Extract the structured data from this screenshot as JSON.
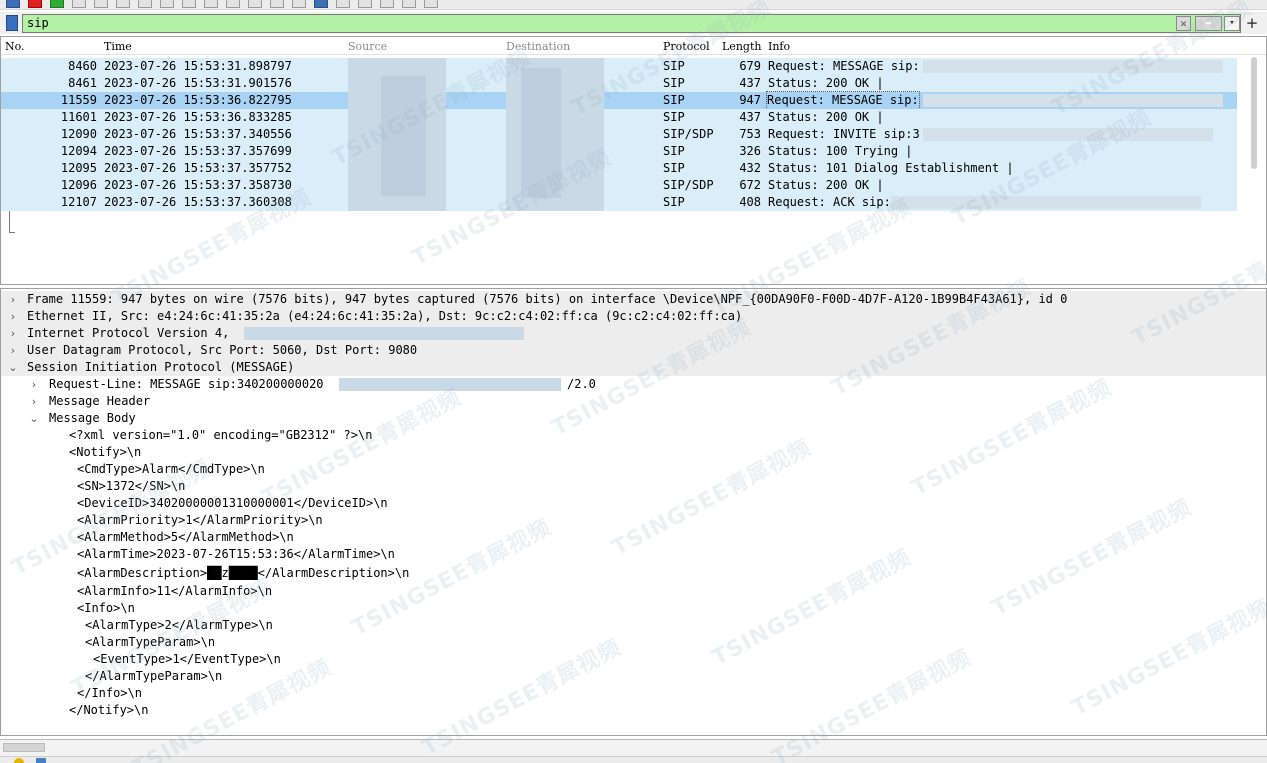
{
  "filter": {
    "value": "sip"
  },
  "packet_list": {
    "columns": [
      "No.",
      "Time",
      "Source",
      "Destination",
      "Protocol",
      "Length",
      "Info"
    ],
    "rows": [
      {
        "no": "8460",
        "time": "2023-07-26 15:53:31.898797",
        "proto": "SIP",
        "len": "679",
        "info": "Request: MESSAGE sip:",
        "selected": false
      },
      {
        "no": "8461",
        "time": "2023-07-26 15:53:31.901576",
        "proto": "SIP",
        "len": "437",
        "info": "Status: 200 OK |",
        "selected": false
      },
      {
        "no": "11559",
        "time": "2023-07-26 15:53:36.822795",
        "proto": "SIP",
        "len": "947",
        "info": "Request: MESSAGE sip:",
        "selected": true
      },
      {
        "no": "11601",
        "time": "2023-07-26 15:53:36.833285",
        "proto": "SIP",
        "len": "437",
        "info": "Status: 200 OK |",
        "selected": false
      },
      {
        "no": "12090",
        "time": "2023-07-26 15:53:37.340556",
        "proto": "SIP/SDP",
        "len": "753",
        "info": "Request: INVITE sip:3",
        "selected": false
      },
      {
        "no": "12094",
        "time": "2023-07-26 15:53:37.357699",
        "proto": "SIP",
        "len": "326",
        "info": "Status: 100 Trying |",
        "selected": false
      },
      {
        "no": "12095",
        "time": "2023-07-26 15:53:37.357752",
        "proto": "SIP",
        "len": "432",
        "info": "Status: 101 Dialog Establishment |",
        "selected": false
      },
      {
        "no": "12096",
        "time": "2023-07-26 15:53:37.358730",
        "proto": "SIP/SDP",
        "len": "672",
        "info": "Status: 200 OK |",
        "selected": false
      },
      {
        "no": "12107",
        "time": "2023-07-26 15:53:37.360308",
        "proto": "SIP",
        "len": "408",
        "info": "Request: ACK sip:",
        "selected": false
      }
    ]
  },
  "details": {
    "lines": [
      {
        "arrow": "collapsed",
        "text": "Frame 11559: 947 bytes on wire (7576 bits), 947 bytes captured (7576 bits) on interface \\Device\\NPF_{00DA90F0-F00D-4D7F-A120-1B99B4F43A61}, id 0",
        "band": true
      },
      {
        "arrow": "collapsed",
        "text": "Ethernet II, Src: e4:24:6c:41:35:2a (e4:24:6c:41:35:2a), Dst: 9c:c2:c4:02:ff:ca (9c:c2:c4:02:ff:ca)",
        "band": true
      },
      {
        "arrow": "collapsed",
        "text": "Internet Protocol Version 4,",
        "band": true
      },
      {
        "arrow": "collapsed",
        "text": "User Datagram Protocol, Src Port: 5060, Dst Port: 9080",
        "band": true
      },
      {
        "arrow": "expanded",
        "text": "Session Initiation Protocol (MESSAGE)",
        "band": true
      },
      {
        "arrow": "collapsed",
        "text": "Request-Line: MESSAGE sip:340200000020",
        "suffix": "/2.0",
        "band": false
      },
      {
        "arrow": "collapsed",
        "text": "Message Header",
        "band": false
      },
      {
        "arrow": "expanded",
        "text": "Message Body",
        "band": false
      },
      {
        "arrow": "none",
        "text": "<?xml version=\"1.0\" encoding=\"GB2312\" ?>\\n",
        "band": false
      },
      {
        "arrow": "none",
        "text": "<Notify>\\n",
        "band": false
      },
      {
        "arrow": "none",
        "text": "<CmdType>Alarm</CmdType>\\n",
        "band": false
      },
      {
        "arrow": "none",
        "text": "<SN>1372</SN>\\n",
        "band": false
      },
      {
        "arrow": "none",
        "text": "<DeviceID>34020000001310000001</DeviceID>\\n",
        "band": false
      },
      {
        "arrow": "none",
        "text": "<AlarmPriority>1</AlarmPriority>\\n",
        "band": false
      },
      {
        "arrow": "none",
        "text": "<AlarmMethod>5</AlarmMethod>\\n",
        "band": false
      },
      {
        "arrow": "none",
        "text": "<AlarmTime>2023-07-26T15:53:36</AlarmTime>\\n",
        "band": false
      },
      {
        "arrow": "none",
        "text": "<AlarmDescription>██z████</AlarmDescription>\\n",
        "band": false
      },
      {
        "arrow": "none",
        "text": "<AlarmInfo>11</AlarmInfo>\\n",
        "band": false
      },
      {
        "arrow": "none",
        "text": "<Info>\\n",
        "band": false
      },
      {
        "arrow": "none",
        "text": "<AlarmType>2</AlarmType>\\n",
        "band": false
      },
      {
        "arrow": "none",
        "text": "<AlarmTypeParam>\\n",
        "band": false
      },
      {
        "arrow": "none",
        "text": "<EventType>1</EventType>\\n",
        "band": false
      },
      {
        "arrow": "none",
        "text": "</AlarmTypeParam>\\n",
        "band": false
      },
      {
        "arrow": "none",
        "text": "</Info>\\n",
        "band": false
      },
      {
        "arrow": "none",
        "text": "</Notify>\\n",
        "band": false
      }
    ]
  },
  "watermark": {
    "text": "TSINGSEE青犀视频"
  },
  "colors": {
    "filter_ok": "#b3f2a6",
    "row_bg": "#daeefa",
    "row_selected": "#a9d3f4"
  }
}
